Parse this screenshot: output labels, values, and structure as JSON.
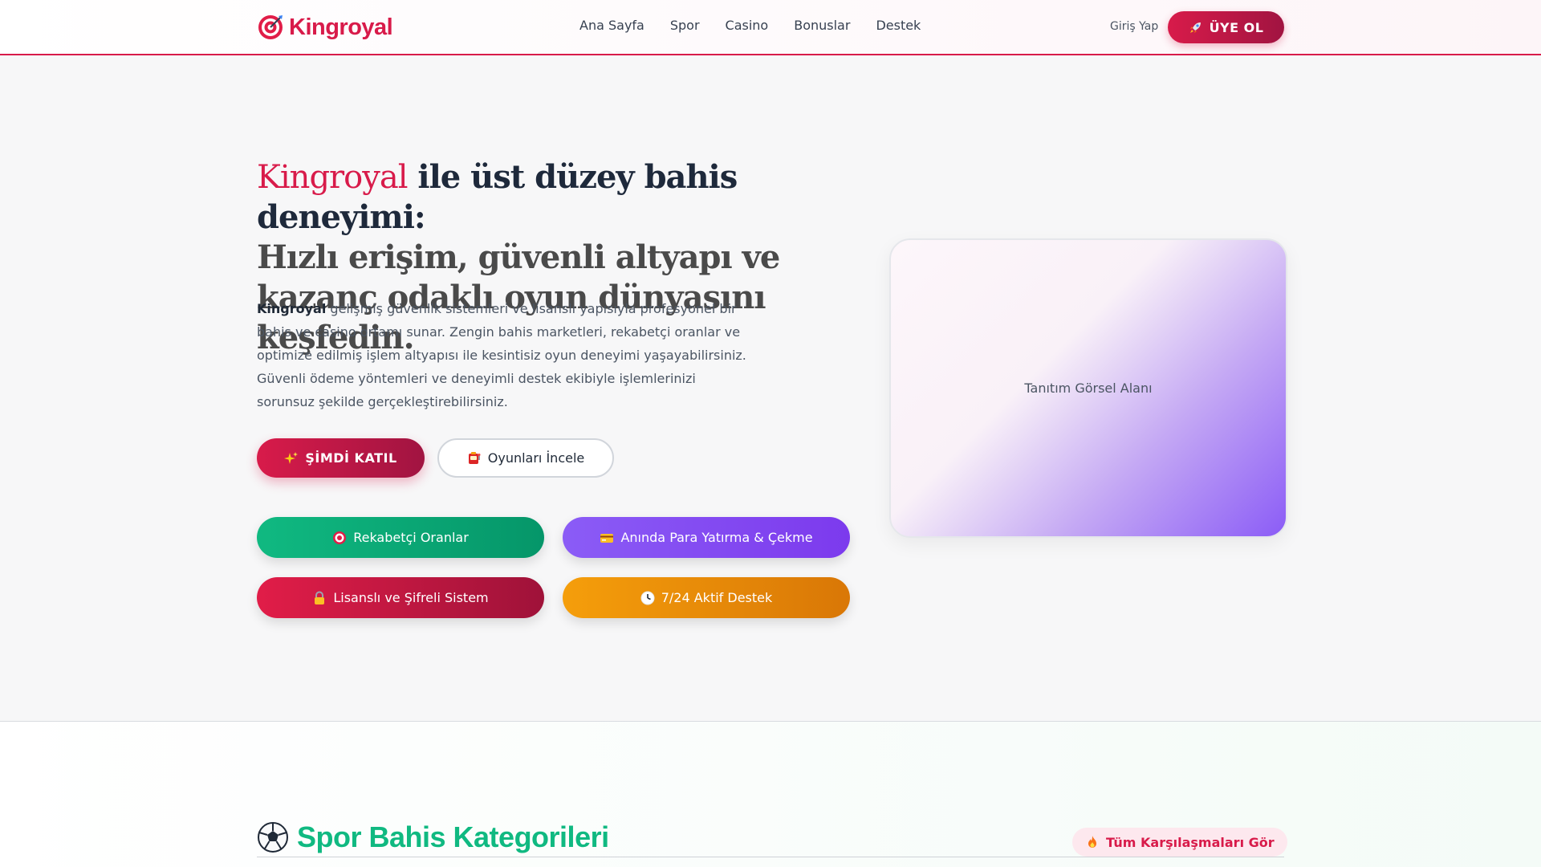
{
  "header": {
    "brand": "Kingroyal",
    "nav": [
      "Ana Sayfa",
      "Spor",
      "Casino",
      "Bonuslar",
      "Destek"
    ],
    "login": "Giriş Yap",
    "signup": "ÜYE OL"
  },
  "hero": {
    "title_brand": "Kingroyal",
    "title_line1": " ile üst düzey bahis deneyimi:",
    "title_rest": "Hızlı erişim, güvenli altyapı ve kazanç odaklı oyun dünyasını keşfedin.",
    "desc_brand": "Kingroyal",
    "desc_text": " gelişmiş güvenlik sistemleri ve lisanslı yapısıyla profesyonel bir bahis ve casino ortamı sunar. Zengin bahis marketleri, rekabetçi oranlar ve optimize edilmiş işlem altyapısı ile kesintisiz oyun deneyimi yaşayabilirsiniz. Güvenli ödeme yöntemleri ve deneyimli destek ekibiyle işlemlerinizi sorunsuz şekilde gerçekleştirebilirsiniz.",
    "join_label": "ŞİMDİ KATIL",
    "games_label": "Oyunları İncele",
    "features": [
      "Rekabetçi Oranlar",
      "Anında Para Yatırma & Çekme",
      "Lisanslı ve Şifreli Sistem",
      "7/24 Aktif Destek"
    ],
    "promo_label": "Tanıtım Görsel Alanı"
  },
  "sports": {
    "title": "Spor Bahis Kategorileri",
    "all_matches": "Tüm Karşılaşmaları Gör"
  },
  "colors": {
    "brand": "#d81b4a",
    "green": "#10b981",
    "purple": "#8b5cf6",
    "orange": "#f59e0b"
  },
  "icons": {
    "logo": "target-icon",
    "signup": "rocket-icon",
    "join": "sparkles-icon",
    "games": "slot-machine-icon",
    "features": [
      "target-icon",
      "credit-card-icon",
      "lock-icon",
      "clock-icon"
    ],
    "sports": "soccer-ball-icon",
    "all_matches": "fire-icon"
  }
}
